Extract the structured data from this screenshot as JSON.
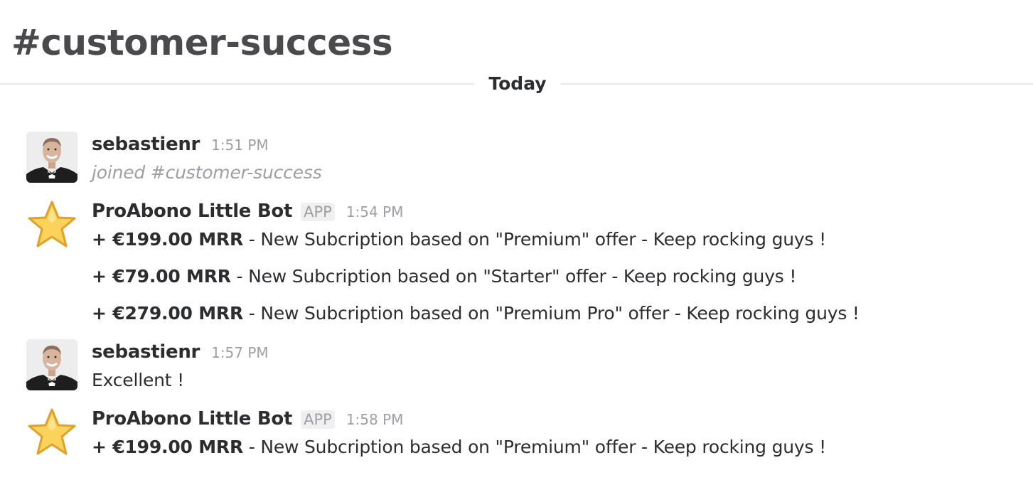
{
  "channel": {
    "title": "#customer-success"
  },
  "divider": {
    "label": "Today"
  },
  "messages": [
    {
      "sender": "sebastienr",
      "time": "1:51 PM",
      "lines": [
        {
          "text": "joined #customer-success"
        }
      ]
    },
    {
      "sender": "ProAbono Little Bot",
      "badge": "APP",
      "time": "1:54 PM",
      "lines": [
        {
          "amount": "+ €199.00 MRR",
          "text": " - New Subcription based on \"Premium\" offer - Keep rocking guys !"
        },
        {
          "amount": "+ €79.00 MRR",
          "text": " - New Subcription based on \"Starter\" offer - Keep rocking guys !"
        },
        {
          "amount": "+ €279.00 MRR",
          "text": " - New Subcription based on \"Premium Pro\" offer - Keep rocking guys !"
        }
      ]
    },
    {
      "sender": "sebastienr",
      "time": "1:57 PM",
      "lines": [
        {
          "text": "Excellent !"
        }
      ]
    },
    {
      "sender": "ProAbono Little Bot",
      "badge": "APP",
      "time": "1:58 PM",
      "lines": [
        {
          "amount": "+ €199.00 MRR",
          "text": " - New Subcription based on \"Premium\" offer - Keep rocking guys !"
        }
      ]
    }
  ],
  "icons": {
    "user_avatar": "user-avatar",
    "bot_avatar": "star-icon"
  },
  "colors": {
    "title": "#4a4a4e",
    "text": "#2c2d30",
    "muted": "#9e9ea6",
    "star_fill": "#fbd35a",
    "star_stroke": "#e0a12a"
  }
}
